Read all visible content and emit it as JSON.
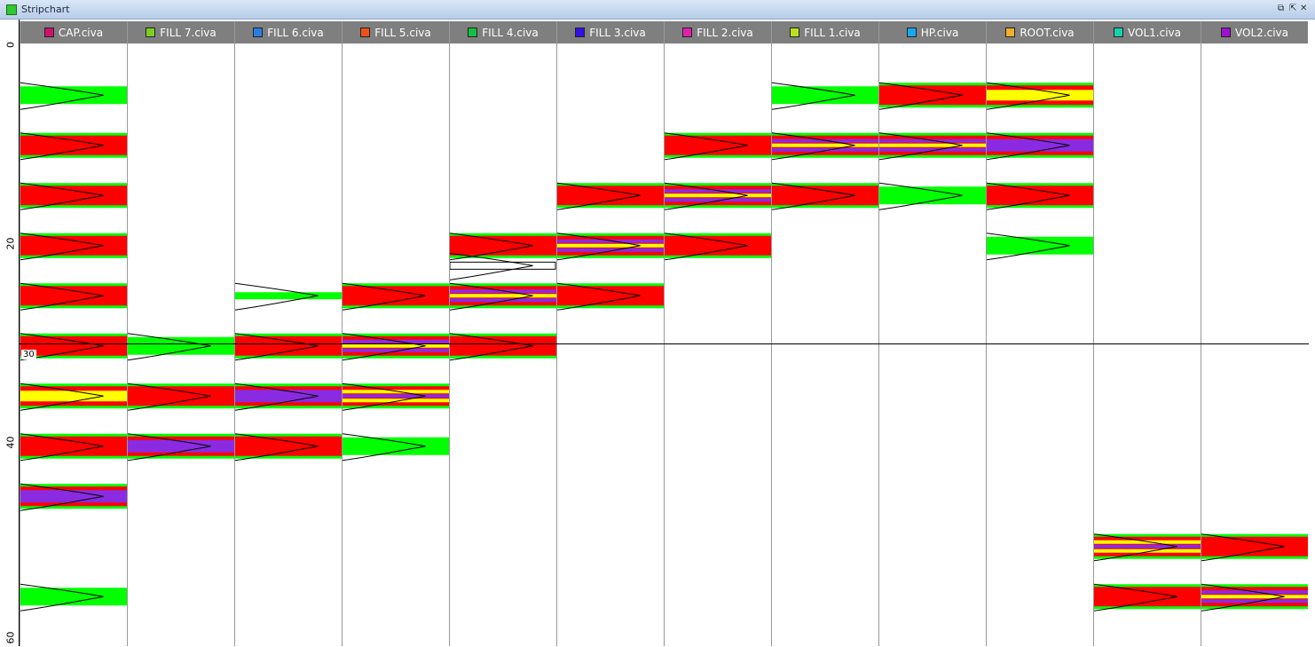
{
  "window": {
    "title": "Stripchart",
    "controls": [
      "⧉",
      "⇱",
      "✕"
    ]
  },
  "axis": {
    "ticks": [
      "0",
      "20",
      "40",
      "60"
    ],
    "cursor_readout": "30"
  },
  "columns": [
    {
      "label": "CAP.civa",
      "color": "#d01070"
    },
    {
      "label": "FILL 7.civa",
      "color": "#7ccf22"
    },
    {
      "label": "FILL 6.civa",
      "color": "#2a7de0"
    },
    {
      "label": "FILL 5.civa",
      "color": "#f05018"
    },
    {
      "label": "FILL 4.civa",
      "color": "#10c040"
    },
    {
      "label": "FILL 3.civa",
      "color": "#3010e8"
    },
    {
      "label": "FILL 2.civa",
      "color": "#e020b0"
    },
    {
      "label": "FILL 1.civa",
      "color": "#b8e020"
    },
    {
      "label": "HP.civa",
      "color": "#18a8f0"
    },
    {
      "label": "ROOT.civa",
      "color": "#f0b030"
    },
    {
      "label": "VOL1.civa",
      "color": "#18d0b0"
    },
    {
      "label": "VOL2.civa",
      "color": "#a010d0"
    }
  ],
  "bands": [
    [
      {
        "depth": 5,
        "type": "green"
      },
      {
        "depth": 10,
        "type": "red"
      },
      {
        "depth": 15,
        "type": "red"
      },
      {
        "depth": 20,
        "type": "red"
      },
      {
        "depth": 25,
        "type": "red"
      },
      {
        "depth": 30,
        "type": "red"
      },
      {
        "depth": 35,
        "type": "yellow"
      },
      {
        "depth": 40,
        "type": "red"
      },
      {
        "depth": 45,
        "type": "purple"
      },
      {
        "depth": 55,
        "type": "green"
      }
    ],
    [
      {
        "depth": 30,
        "type": "green"
      },
      {
        "depth": 35,
        "type": "red"
      },
      {
        "depth": 40,
        "type": "purple"
      }
    ],
    [
      {
        "depth": 25,
        "type": "thin-green"
      },
      {
        "depth": 30,
        "type": "red"
      },
      {
        "depth": 35,
        "type": "purple"
      },
      {
        "depth": 40,
        "type": "red"
      }
    ],
    [
      {
        "depth": 25,
        "type": "red"
      },
      {
        "depth": 30,
        "type": "stripe"
      },
      {
        "depth": 35,
        "type": "stripe-yellow"
      },
      {
        "depth": 40,
        "type": "green"
      }
    ],
    [
      {
        "depth": 20,
        "type": "red"
      },
      {
        "depth": 22,
        "type": "outline"
      },
      {
        "depth": 25,
        "type": "stripe"
      },
      {
        "depth": 30,
        "type": "red"
      }
    ],
    [
      {
        "depth": 15,
        "type": "red"
      },
      {
        "depth": 20,
        "type": "stripe"
      },
      {
        "depth": 25,
        "type": "red"
      }
    ],
    [
      {
        "depth": 10,
        "type": "red"
      },
      {
        "depth": 15,
        "type": "stripe"
      },
      {
        "depth": 20,
        "type": "red"
      }
    ],
    [
      {
        "depth": 5,
        "type": "green"
      },
      {
        "depth": 10,
        "type": "stripe"
      },
      {
        "depth": 15,
        "type": "red"
      }
    ],
    [
      {
        "depth": 5,
        "type": "red"
      },
      {
        "depth": 10,
        "type": "stripe"
      },
      {
        "depth": 15,
        "type": "green"
      }
    ],
    [
      {
        "depth": 5,
        "type": "yellow"
      },
      {
        "depth": 10,
        "type": "purple"
      },
      {
        "depth": 15,
        "type": "red"
      },
      {
        "depth": 20,
        "type": "green"
      }
    ],
    [
      {
        "depth": 50,
        "type": "stripe-yellow"
      },
      {
        "depth": 55,
        "type": "red"
      }
    ],
    [
      {
        "depth": 50,
        "type": "red"
      },
      {
        "depth": 55,
        "type": "stripe"
      }
    ]
  ]
}
